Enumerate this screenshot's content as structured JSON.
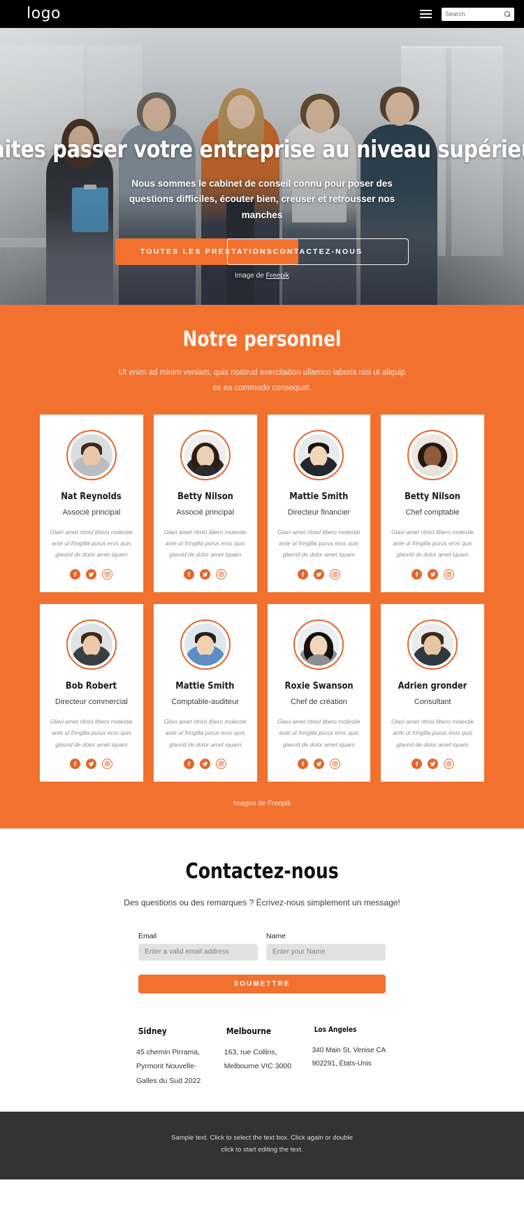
{
  "header": {
    "logo": "logo",
    "menu_icon": "hamburger-icon",
    "search": {
      "value": "",
      "placeholder": "Search",
      "icon": "search-icon"
    }
  },
  "hero": {
    "title": "Faites passer votre entreprise au niveau supérieur",
    "subtitle": "Nous sommes le cabinet de conseil connu pour poser des questions difficiles, écouter bien, creuser et retrousser nos manches",
    "primary_button": "TOUTES LES PRESTATIONS",
    "secondary_button": "CONTACTEZ-NOUS",
    "credit_prefix": "Image de ",
    "credit_link": "Freepik"
  },
  "team": {
    "title": "Notre personnel",
    "subtitle": "Ut enim ad minim veniam, quis nostrud exercitation ullamco laboris nisi ut aliquip ex ea commodo consequat.",
    "credit": "Images de Freepik",
    "description": "Glavi amet ritnisl libero molestie ante ut fringilla purus eros quis glavrid de dolor amet iquam",
    "social_icons": [
      "facebook-icon",
      "twitter-icon",
      "instagram-icon"
    ],
    "members": [
      {
        "name": "Nat Reynolds",
        "role": "Associé principal",
        "desc": "Glavi amet ritnisl libero molestie ante ut fringilla purus eros quis glavrid de dolor amet iquam"
      },
      {
        "name": "Betty Nilson",
        "role": "Associé principal",
        "desc": "Glavi amet ritnisl libero molestie ante ut fringilla purus eros quis glavrid de dolor amet iquam"
      },
      {
        "name": "Mattie Smith",
        "role": "Directeur financier",
        "desc": "Glavi amet ritnisl libero molestie ante ut fringilla purus eros quis glavrid de dolor amet iquam"
      },
      {
        "name": "Betty Nilson",
        "role": "Chef comptable",
        "desc": "Glavi amet ritnisl libero molestie ante ut fringilla purus eros quis glavrid de dolor amet iquam"
      },
      {
        "name": "Bob Robert",
        "role": "Directeur commercial",
        "desc": "Glavi amet ritnisl libero molestie ante ut fringilla purus eros quis glavrid de dolor amet iquam"
      },
      {
        "name": "Mattie Smith",
        "role": "Comptable-auditeur",
        "desc": "Glavi amet ritnisl libero molestie ante ut fringilla purus eros quis glavrid de dolor amet iquam"
      },
      {
        "name": "Roxie Swanson",
        "role": "Chef de création",
        "desc": "Glavi amet ritnisl libero molestie ante ut fringilla purus eros quis glavrid de dolor amet iquam"
      },
      {
        "name": "Adrien gronder",
        "role": "Consultant",
        "desc": "Glavi amet ritnisl libero molestie ante ut fringilla purus eros quis glavrid de dolor amet iquam"
      }
    ]
  },
  "contact": {
    "title": "Contactez-nous",
    "subtitle": "Des questions ou des remarques ? Écrivez-nous simplement un message!",
    "email_label": "Email",
    "email_placeholder": "Enter a valid email address",
    "email_value": "",
    "name_label": "Name",
    "name_placeholder": "Enter your Name",
    "name_value": "",
    "submit_label": "SOUMETTRE",
    "addresses": [
      {
        "city": "Sidney",
        "lines": "45 chemin Pirrama, Pyrmont Nouvelle-Galles du Sud 2022"
      },
      {
        "city": "Melbourne",
        "lines": "163, rue Collins, Melbourne VIC 3000"
      },
      {
        "city": "Los Angeles",
        "lines": "340 Main St, Venise CA 902291, États-Unis"
      }
    ]
  },
  "footer": {
    "line1": "Sample text. Click to select the text box. Click again or double",
    "line2": "click to start editing the text."
  },
  "colors": {
    "accent": "#F2712F",
    "accent_dark": "#E4662B",
    "header_bg": "#000000",
    "footer_bg": "#333333",
    "input_bg": "#E2E2E2"
  }
}
